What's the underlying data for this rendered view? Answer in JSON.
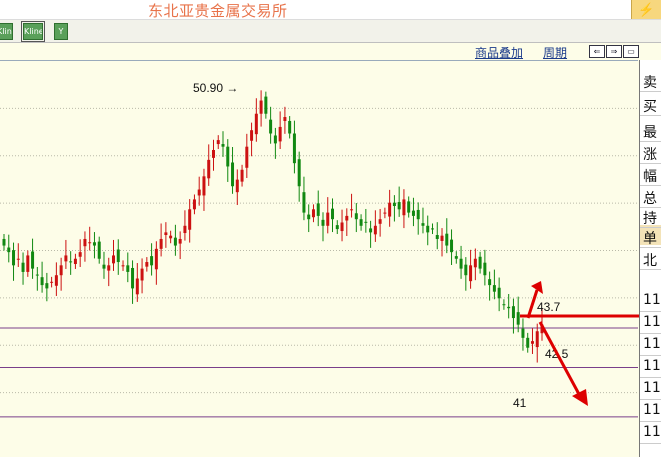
{
  "window": {
    "title": "东北亚贵金属交易所",
    "corner_icon": "lightning-icon"
  },
  "toolbar": {
    "buttons": [
      {
        "label": "Kline",
        "icon": "kline-icon"
      },
      {
        "label": "Kline",
        "icon": "kline-icon",
        "selected": true
      },
      {
        "label": "Y",
        "icon": "filter-icon"
      }
    ]
  },
  "header": {
    "product_overlay": "商品叠加",
    "period": "周期"
  },
  "annotations": {
    "high_label": "50.90",
    "level_upper": "43.7",
    "level_mid": "42.5",
    "level_low": "41"
  },
  "quote_panel": {
    "rows": [
      "卖",
      "买",
      "最",
      "涨",
      "幅",
      "总",
      "持",
      "单",
      "北",
      "11",
      "11",
      "11",
      "11",
      "11",
      "11",
      "11"
    ]
  },
  "chart_data": {
    "type": "candlestick",
    "title": "",
    "xlabel": "",
    "ylabel": "",
    "ylim": [
      40.3,
      51.8
    ],
    "up_color": "#cc1111",
    "down_color": "#118811",
    "horizontal_lines": [
      43.7,
      42.5,
      41
    ],
    "annotations": [
      "50.90",
      "43.7",
      "42.5",
      "41"
    ],
    "close_series": [
      46.2,
      46.0,
      45.6,
      45.8,
      45.4,
      45.9,
      45.5,
      45.3,
      45.0,
      44.9,
      45.1,
      45.3,
      45.6,
      45.9,
      45.7,
      45.8,
      46.0,
      46.4,
      46.3,
      46.2,
      45.8,
      45.5,
      45.6,
      45.9,
      45.7,
      45.6,
      45.4,
      44.9,
      45.2,
      45.5,
      45.7,
      45.6,
      46.1,
      46.4,
      46.6,
      46.5,
      46.2,
      46.4,
      46.8,
      47.3,
      47.6,
      47.9,
      48.3,
      48.8,
      49.1,
      49.4,
      49.2,
      48.6,
      48.0,
      48.2,
      48.5,
      49.2,
      49.7,
      50.2,
      50.6,
      50.2,
      49.6,
      49.3,
      49.8,
      50.1,
      49.6,
      48.7,
      48.0,
      47.2,
      47.0,
      47.3,
      47.1,
      46.8,
      47.2,
      47.0,
      46.7,
      46.9,
      47.1,
      47.3,
      47.0,
      46.8,
      46.9,
      46.6,
      46.8,
      47.0,
      47.2,
      47.5,
      47.4,
      47.3,
      47.6,
      47.2,
      47.1,
      47.0,
      46.8,
      46.6,
      46.7,
      46.4,
      46.5,
      46.2,
      46.0,
      45.8,
      45.5,
      45.3,
      45.6,
      45.8,
      45.5,
      45.3,
      45.0,
      44.8,
      44.6,
      44.4,
      44.3,
      44.0,
      43.8,
      43.4,
      43.1,
      43.3,
      43.6,
      43.8
    ]
  }
}
